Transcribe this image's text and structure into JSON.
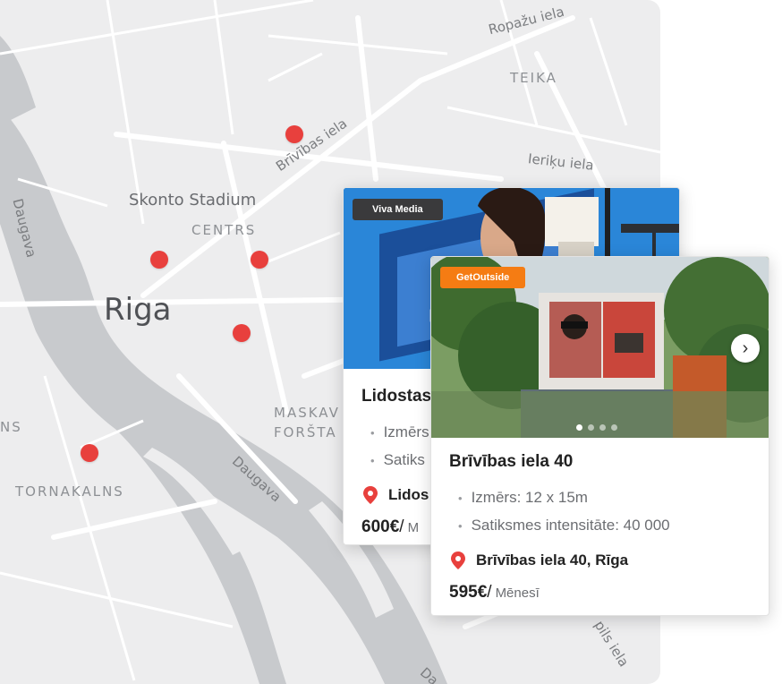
{
  "map": {
    "labels": {
      "ropazu": "Ropažu iela",
      "teika": "TEIKA",
      "brivibas": "Brīvības iela",
      "ieriku": "Ieriķu iela",
      "skonto": "Skonto Stadium",
      "centrs": "CENTRS",
      "riga": "Riga",
      "daugava_river": "Daugava",
      "maskavas": "MASKAV",
      "forstat": "FORŠTA",
      "ns": "NS",
      "tornakalns": "TORNAKALNS",
      "daugava_road": "Daugava",
      "pils": "pils iela",
      "da_bottom": "Da"
    },
    "pin_color": "#e8403d"
  },
  "cards": [
    {
      "badge": "Viva Media",
      "badge_color": "#3a3a3c",
      "title": "Lidostas",
      "specs": [
        "Izmērs",
        "Satiks"
      ],
      "address": "Lidos",
      "price": "600€",
      "slash": "/",
      "unit": "M"
    },
    {
      "badge": "GetOutside",
      "badge_color": "#f57c13",
      "title": "Brīvības iela 40",
      "specs": [
        "Izmērs: 12 x 15m",
        "Satiksmes intensitāte: 40 000"
      ],
      "address": "Brīvības iela 40, Rīga",
      "price": "595€",
      "slash": "/",
      "unit": "Mēnesī",
      "next_icon": "chevron-right-icon",
      "carousel": {
        "total": 4,
        "active": 1
      }
    }
  ]
}
